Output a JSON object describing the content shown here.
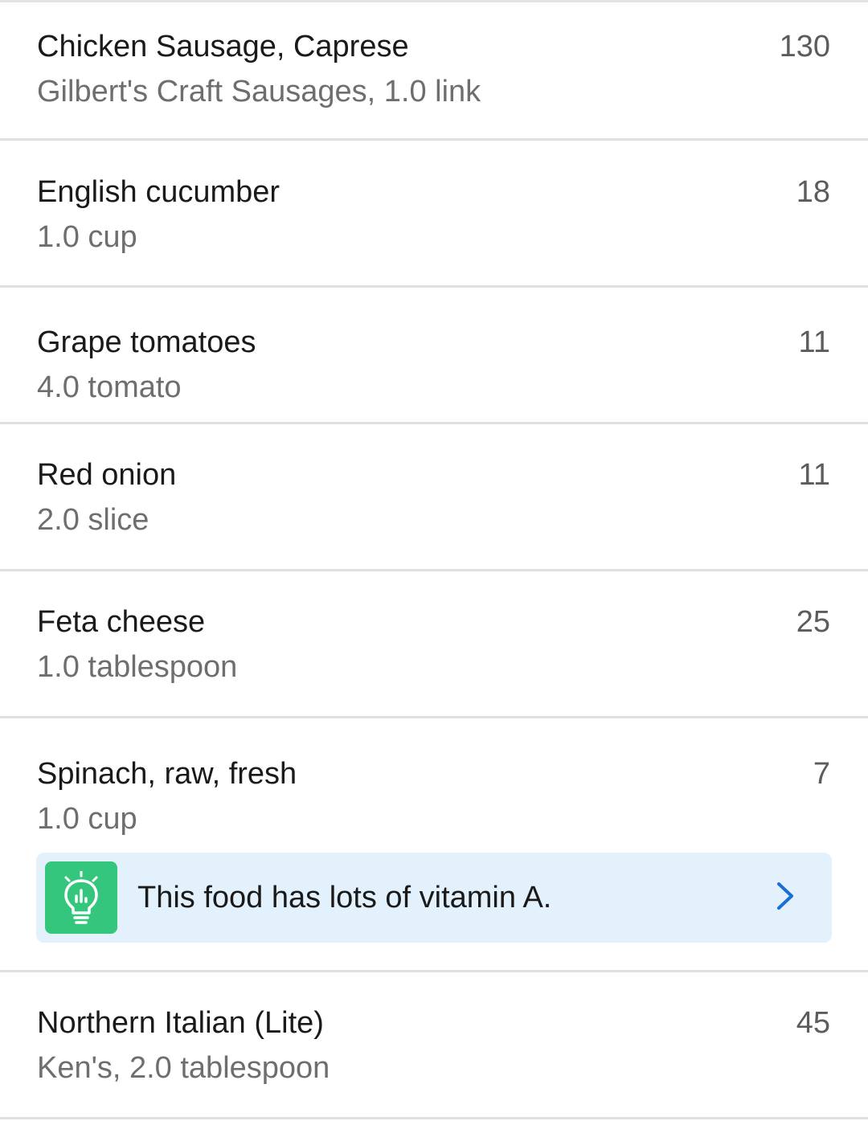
{
  "foods": [
    {
      "name": "Chicken Sausage, Caprese",
      "detail": "Gilbert's Craft Sausages, 1.0 link",
      "calories": "130"
    },
    {
      "name": "English cucumber",
      "detail": "1.0 cup",
      "calories": "18"
    },
    {
      "name": "Grape tomatoes",
      "detail": "4.0 tomato",
      "calories": "11"
    },
    {
      "name": "Red onion",
      "detail": "2.0 slice",
      "calories": "11"
    },
    {
      "name": "Feta cheese",
      "detail": "1.0 tablespoon",
      "calories": "25"
    },
    {
      "name": "Spinach, raw, fresh",
      "detail": "1.0 cup",
      "calories": "7"
    },
    {
      "name": "Northern Italian (Lite)",
      "detail": "Ken's, 2.0 tablespoon",
      "calories": "45"
    }
  ],
  "tip": {
    "text": "This food has lots of vitamin A.",
    "icon": "lightbulb-chart-icon",
    "chevron_icon": "chevron-right-icon"
  },
  "colors": {
    "tip_background": "#e2f1fb",
    "tip_icon_background": "#35c67d",
    "chevron": "#1a6fd6",
    "divider": "#e0e0e0"
  }
}
